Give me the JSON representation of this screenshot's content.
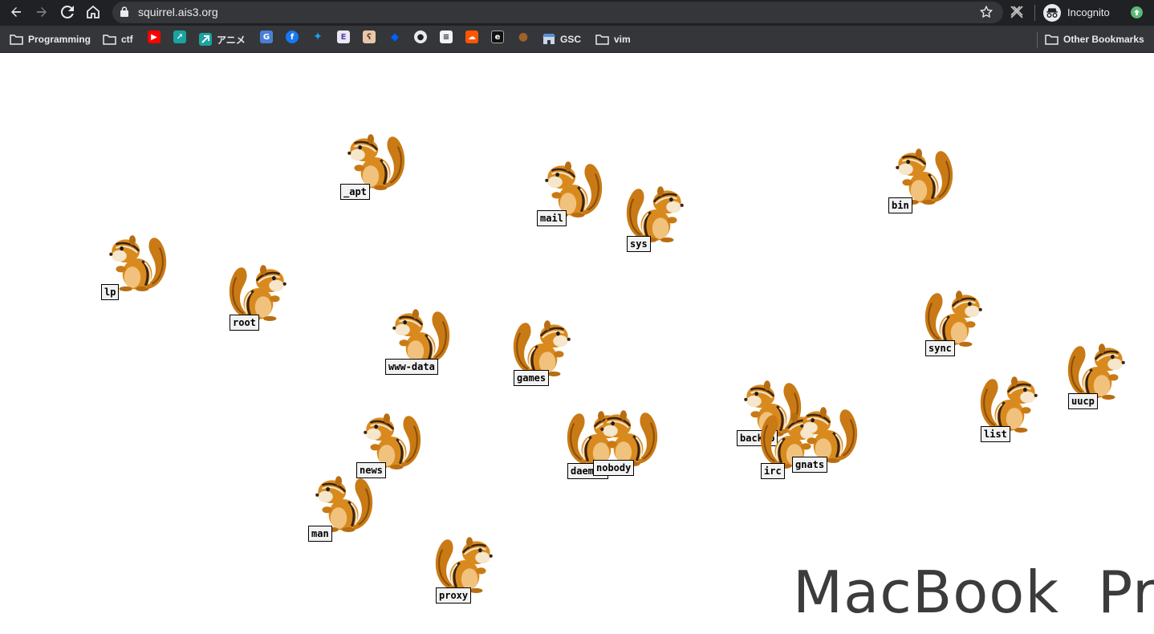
{
  "browser": {
    "url": "squirrel.ais3.org",
    "profile_label": "Incognito"
  },
  "bookmarks": {
    "programming": "Programming",
    "ctf": "ctf",
    "anime": "アニメ",
    "gsc": "GSC",
    "vim": "vim",
    "other": "Other Bookmarks",
    "favicons": [
      "youtube-icon",
      "teal-app-icon",
      "teal-app-icon",
      "google-translate-icon",
      "facebook-icon",
      "twitter-icon",
      "e-icon",
      "bear-icon",
      "dropbox-icon",
      "github-icon",
      "docs-icon",
      "soundcloud-icon",
      "e-dark-icon",
      "chestnut-icon",
      "store-icon"
    ]
  },
  "users": [
    {
      "name": "lp"
    },
    {
      "name": "_apt"
    },
    {
      "name": "mail"
    },
    {
      "name": "sys"
    },
    {
      "name": "bin"
    },
    {
      "name": "root"
    },
    {
      "name": "www-data"
    },
    {
      "name": "games"
    },
    {
      "name": "sync"
    },
    {
      "name": "uucp"
    },
    {
      "name": "list"
    },
    {
      "name": "news"
    },
    {
      "name": "man"
    },
    {
      "name": "daemon"
    },
    {
      "name": "nobody"
    },
    {
      "name": "backup"
    },
    {
      "name": "irc"
    },
    {
      "name": "gnats"
    },
    {
      "name": "proxy"
    }
  ],
  "watermark": "MacBook Pro",
  "colors": {
    "toolbar": "#202124",
    "bookmarks_bar": "#35363a",
    "label_bg": "#f2f2f2",
    "squirrel_body": "#d98a1e"
  }
}
